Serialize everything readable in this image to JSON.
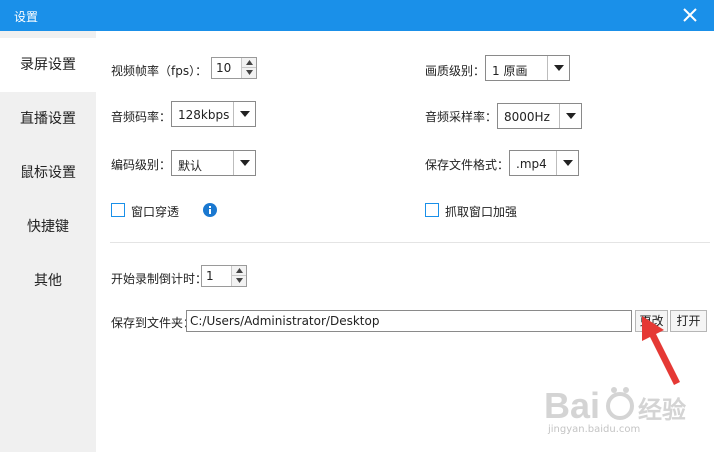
{
  "window": {
    "title": "设置"
  },
  "sidebar": {
    "items": [
      {
        "label": "录屏设置"
      },
      {
        "label": "直播设置"
      },
      {
        "label": "鼠标设置"
      },
      {
        "label": "快捷键"
      },
      {
        "label": "其他"
      }
    ]
  },
  "settings": {
    "fps": {
      "label": "视频帧率（fps）：",
      "value": "10"
    },
    "quality": {
      "label": "画质级别：",
      "value": "1 原画"
    },
    "audio_bitrate": {
      "label": "音频码率：",
      "value": "128kbps"
    },
    "sample_rate": {
      "label": "音频采样率：",
      "value": "8000Hz"
    },
    "encode_level": {
      "label": "编码级别：",
      "value": "默认"
    },
    "file_format": {
      "label": "保存文件格式：",
      "value": ".mp4"
    },
    "window_penetrate": {
      "label": "窗口穿透",
      "checked": false
    },
    "capture_boost": {
      "label": "抓取窗口加强",
      "checked": false
    },
    "countdown": {
      "label": "开始录制倒计时：",
      "value": "1"
    },
    "save_folder": {
      "label": "保存到文件夹：",
      "value": "C:/Users/Administrator/Desktop"
    },
    "change_button": "更改",
    "open_button": "打开"
  },
  "watermark": {
    "brand": "Bai",
    "brand_cn": "经验",
    "url": "jingyan.baidu.com"
  },
  "colors": {
    "accent": "#1a90e9",
    "arrow": "#e53935"
  }
}
